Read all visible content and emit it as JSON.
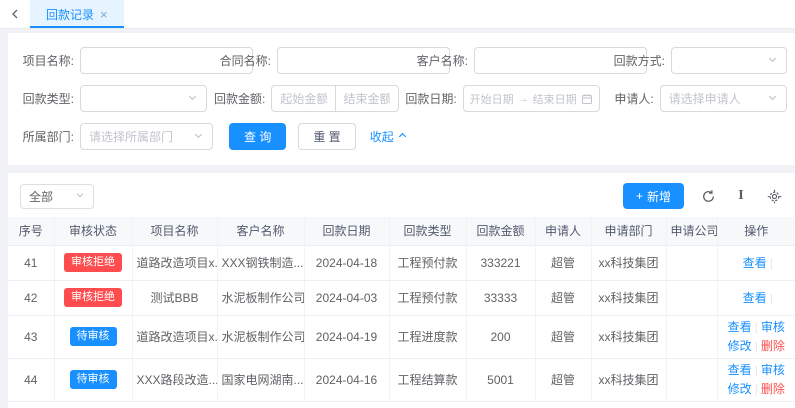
{
  "colors": {
    "primary": "#1890ff",
    "danger": "#ff4d4f",
    "tab_active_bg": "#e6f4ff",
    "page_bg": "#f0f2f5",
    "table_header_bg": "#f7f8fa",
    "border": "#ebeef5",
    "placeholder_text": "#c0c4cc"
  },
  "tab_bar": {
    "active_tab": "回款记录",
    "close": "×"
  },
  "filter": {
    "project_label": "项目名称:",
    "contract_label": "合同名称:",
    "customer_label": "客户名称:",
    "method_label": "回款方式:",
    "type_label": "回款类型:",
    "amount_label": "回款金额:",
    "amount_start_ph": "起始金额",
    "amount_end_ph": "结束金额",
    "date_label": "回款日期:",
    "date_start_ph": "开始日期",
    "date_arrow": "→",
    "date_end_ph": "结束日期",
    "applicant_label": "申请人:",
    "applicant_ph": "请选择申请人",
    "department_label": "所属部门:",
    "department_ph": "请选择所属部门",
    "search_btn": "查 询",
    "reset_btn": "重 置",
    "collapse_btn": "收起"
  },
  "toolbar": {
    "scope_select": "全部",
    "plus": "+",
    "add_btn": "新增"
  },
  "table": {
    "columns": [
      "序号",
      "审核状态",
      "项目名称",
      "客户名称",
      "回款日期",
      "回款类型",
      "回款金额",
      "申请人",
      "申请部门",
      "申请公司",
      "操作"
    ],
    "op_divider": "|",
    "ops": {
      "view": "查看",
      "audit": "审核",
      "edit": "修改",
      "delete": "删除"
    },
    "rows": [
      {
        "no": "41",
        "status": "审核拒绝",
        "project": "道路改造项目x...",
        "customer": "XXX钢铁制造...",
        "date": "2024-04-18",
        "type": "工程预付款",
        "amount": "333221",
        "applicant": "超管",
        "dept": "xx科技集团",
        "company": ""
      },
      {
        "no": "42",
        "status": "审核拒绝",
        "project": "测试BBB",
        "customer": "水泥板制作公司",
        "date": "2024-04-03",
        "type": "工程预付款",
        "amount": "33333",
        "applicant": "超管",
        "dept": "xx科技集团",
        "company": ""
      },
      {
        "no": "43",
        "status": "待审核",
        "project": "道路改造项目x...",
        "customer": "水泥板制作公司",
        "date": "2024-04-19",
        "type": "工程进度款",
        "amount": "200",
        "applicant": "超管",
        "dept": "xx科技集团",
        "company": ""
      },
      {
        "no": "44",
        "status": "待审核",
        "project": "XXX路段改造...",
        "customer": "国家电网湖南...",
        "date": "2024-04-16",
        "type": "工程结算款",
        "amount": "5001",
        "applicant": "超管",
        "dept": "xx科技集团",
        "company": ""
      }
    ]
  }
}
